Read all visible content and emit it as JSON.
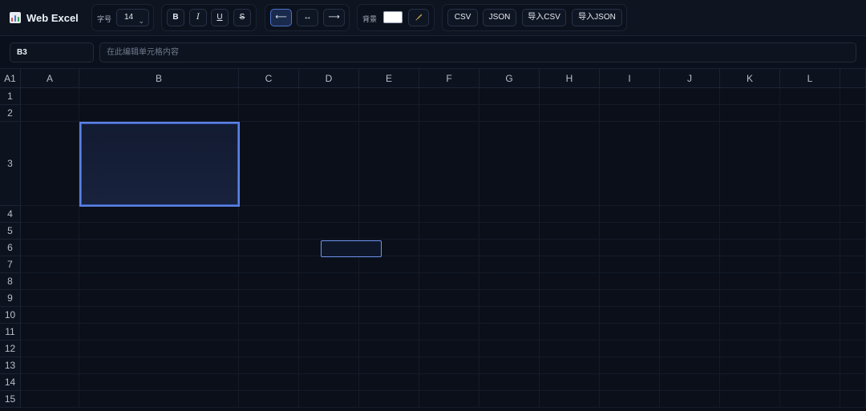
{
  "app": {
    "title": "Web Excel",
    "icon": "bar-chart-icon"
  },
  "toolbar": {
    "font_size_label": "字号",
    "font_size_value": "14",
    "bold_label": "B",
    "italic_label": "I",
    "underline_label": "U",
    "strike_label": "S",
    "align_left_label": "⟵",
    "align_center_label": "↔",
    "align_right_label": "⟶",
    "align_active": "left",
    "background_label": "背景",
    "background_color": "#ffffff",
    "clear_format_icon": "brush-icon",
    "export_csv_label": "CSV",
    "export_json_label": "JSON",
    "import_csv_label": "导入CSV",
    "import_json_label": "导入JSON"
  },
  "formula_bar": {
    "cell_ref": "B3",
    "placeholder": "在此编辑单元格内容",
    "value": ""
  },
  "sheet": {
    "corner_label": "A1",
    "columns": [
      "A",
      "B",
      "C",
      "D",
      "E",
      "F",
      "G",
      "H",
      "I",
      "J",
      "K",
      "L"
    ],
    "rows": [
      "1",
      "2",
      "3",
      "4",
      "5",
      "6",
      "7",
      "8",
      "9",
      "10",
      "11",
      "12",
      "13",
      "14",
      "15"
    ],
    "selected_cell": "B3",
    "editing_cell": "D6",
    "accent_color": "#5b82e3"
  }
}
